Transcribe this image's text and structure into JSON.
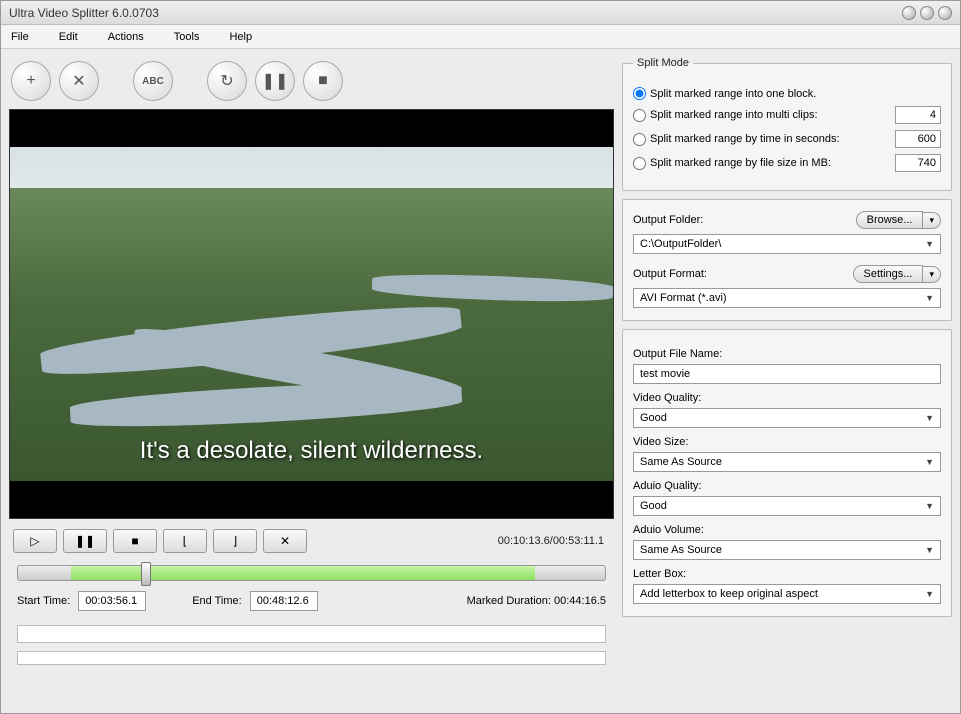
{
  "window": {
    "title": "Ultra Video Splitter 6.0.0703"
  },
  "menu": {
    "file": "File",
    "edit": "Edit",
    "actions": "Actions",
    "tools": "Tools",
    "help": "Help"
  },
  "toolbar": {
    "add": "+",
    "remove": "✕",
    "abc": "ABC",
    "refresh": "↻",
    "pause": "❚❚",
    "stop": "■"
  },
  "video": {
    "subtitle": "It's a desolate, silent wilderness."
  },
  "playback": {
    "time_display": "00:10:13.6/00:53:11.1",
    "start_label": "Start Time:",
    "start_value": "00:03:56.1",
    "end_label": "End Time:",
    "end_value": "00:48:12.6",
    "marked_label": "Marked Duration: 00:44:16.5",
    "range_left_pct": 9,
    "range_right_pct": 88,
    "thumb_pct": 21
  },
  "split_mode": {
    "legend": "Split Mode",
    "opt1": "Split  marked range into one block.",
    "opt2": "Split marked range into multi clips:",
    "opt2_val": "4",
    "opt3": "Split marked range by time in seconds:",
    "opt3_val": "600",
    "opt4": "Split marked range by file size in MB:",
    "opt4_val": "740"
  },
  "output": {
    "folder_label": "Output Folder:",
    "browse": "Browse...",
    "folder_value": "C:\\OutputFolder\\",
    "format_label": "Output Format:",
    "settings": "Settings...",
    "format_value": "AVI Format (*.avi)"
  },
  "settings": {
    "filename_label": "Output File Name:",
    "filename_value": "test movie",
    "vq_label": "Video Quality:",
    "vq_value": "Good",
    "vs_label": "Video Size:",
    "vs_value": "Same As Source",
    "aq_label": "Aduio Quality:",
    "aq_value": "Good",
    "av_label": "Aduio Volume:",
    "av_value": "Same As Source",
    "lb_label": "Letter Box:",
    "lb_value": "Add letterbox to keep original aspect"
  }
}
